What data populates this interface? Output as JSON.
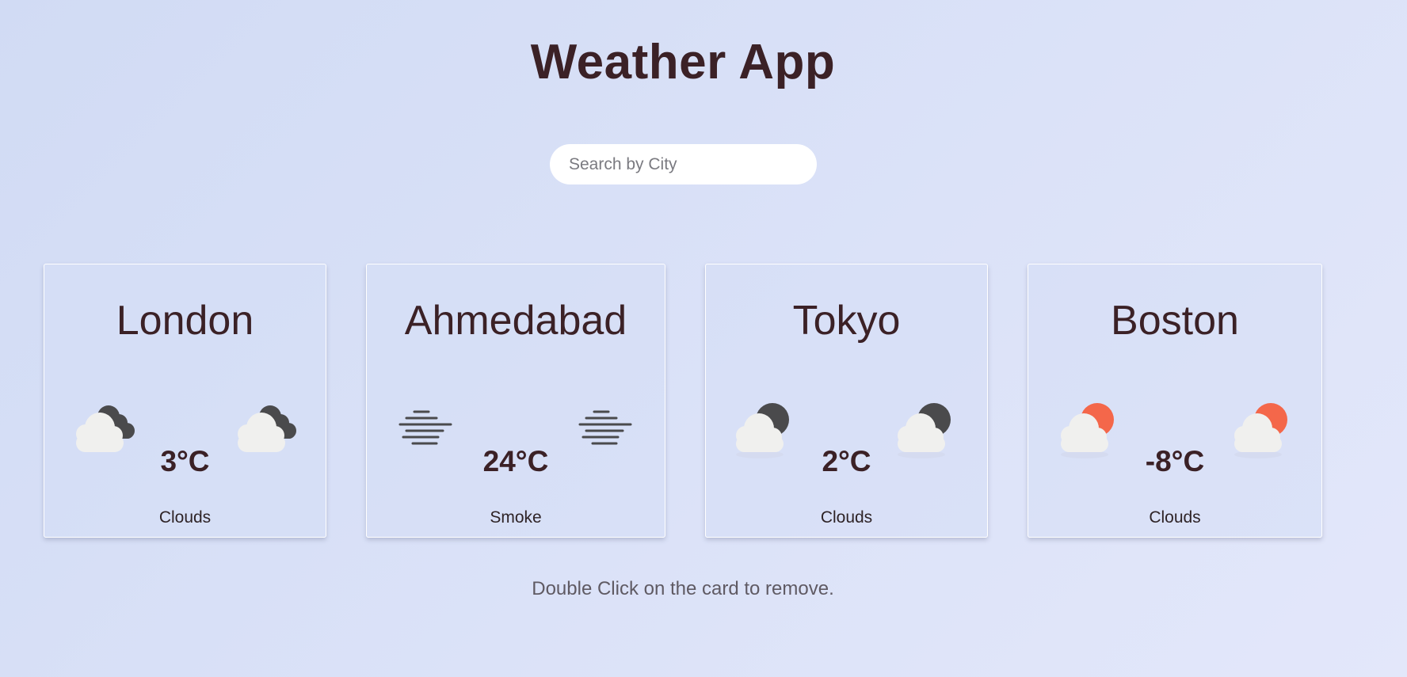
{
  "header": {
    "title": "Weather App"
  },
  "search": {
    "placeholder": "Search by City",
    "value": ""
  },
  "cards": [
    {
      "city": "London",
      "temp": "3°C",
      "description": "Clouds",
      "icon": "cloud-dark-clouds-icon"
    },
    {
      "city": "Ahmedabad",
      "temp": "24°C",
      "description": "Smoke",
      "icon": "mist-lines-icon"
    },
    {
      "city": "Tokyo",
      "temp": "2°C",
      "description": "Clouds",
      "icon": "cloud-moon-icon"
    },
    {
      "city": "Boston",
      "temp": "-8°C",
      "description": "Clouds",
      "icon": "cloud-sun-icon"
    }
  ],
  "footer": {
    "hint": "Double Click on the card to remove."
  },
  "colors": {
    "background": "#d8dff6",
    "text": "#3b2126",
    "cloud": "#f0f0ee",
    "dark_cloud": "#4a4a4c",
    "sun": "#f4674a",
    "moon": "#4a4a4c"
  }
}
